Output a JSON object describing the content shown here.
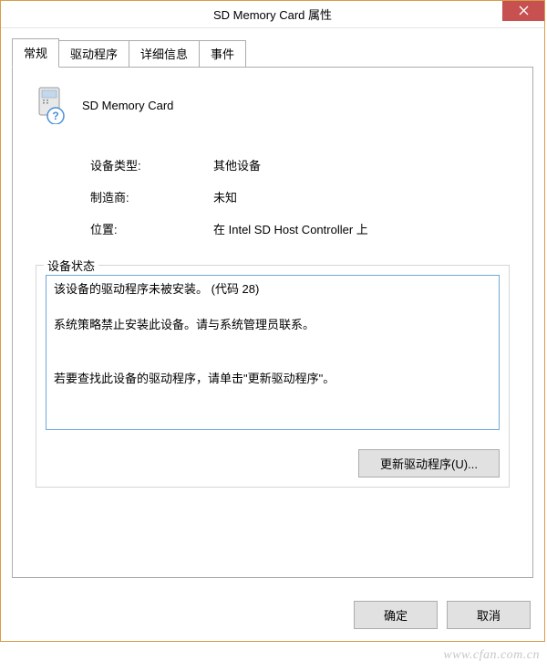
{
  "window": {
    "title": "SD Memory Card 属性"
  },
  "tabs": {
    "general": "常规",
    "driver": "驱动程序",
    "details": "详细信息",
    "events": "事件"
  },
  "device": {
    "name": "SD Memory Card"
  },
  "info": {
    "type_label": "设备类型:",
    "type_value": "其他设备",
    "manufacturer_label": "制造商:",
    "manufacturer_value": "未知",
    "location_label": "位置:",
    "location_value": "在 Intel SD Host Controller 上"
  },
  "status": {
    "legend": "设备状态",
    "text": "该设备的驱动程序未被安装。 (代码 28)\n\n系统策略禁止安装此设备。请与系统管理员联系。\n\n\n若要查找此设备的驱动程序，请单击\"更新驱动程序\"。"
  },
  "buttons": {
    "update_driver": "更新驱动程序(U)...",
    "ok": "确定",
    "cancel": "取消"
  },
  "watermark": "www.cfan.com.cn"
}
